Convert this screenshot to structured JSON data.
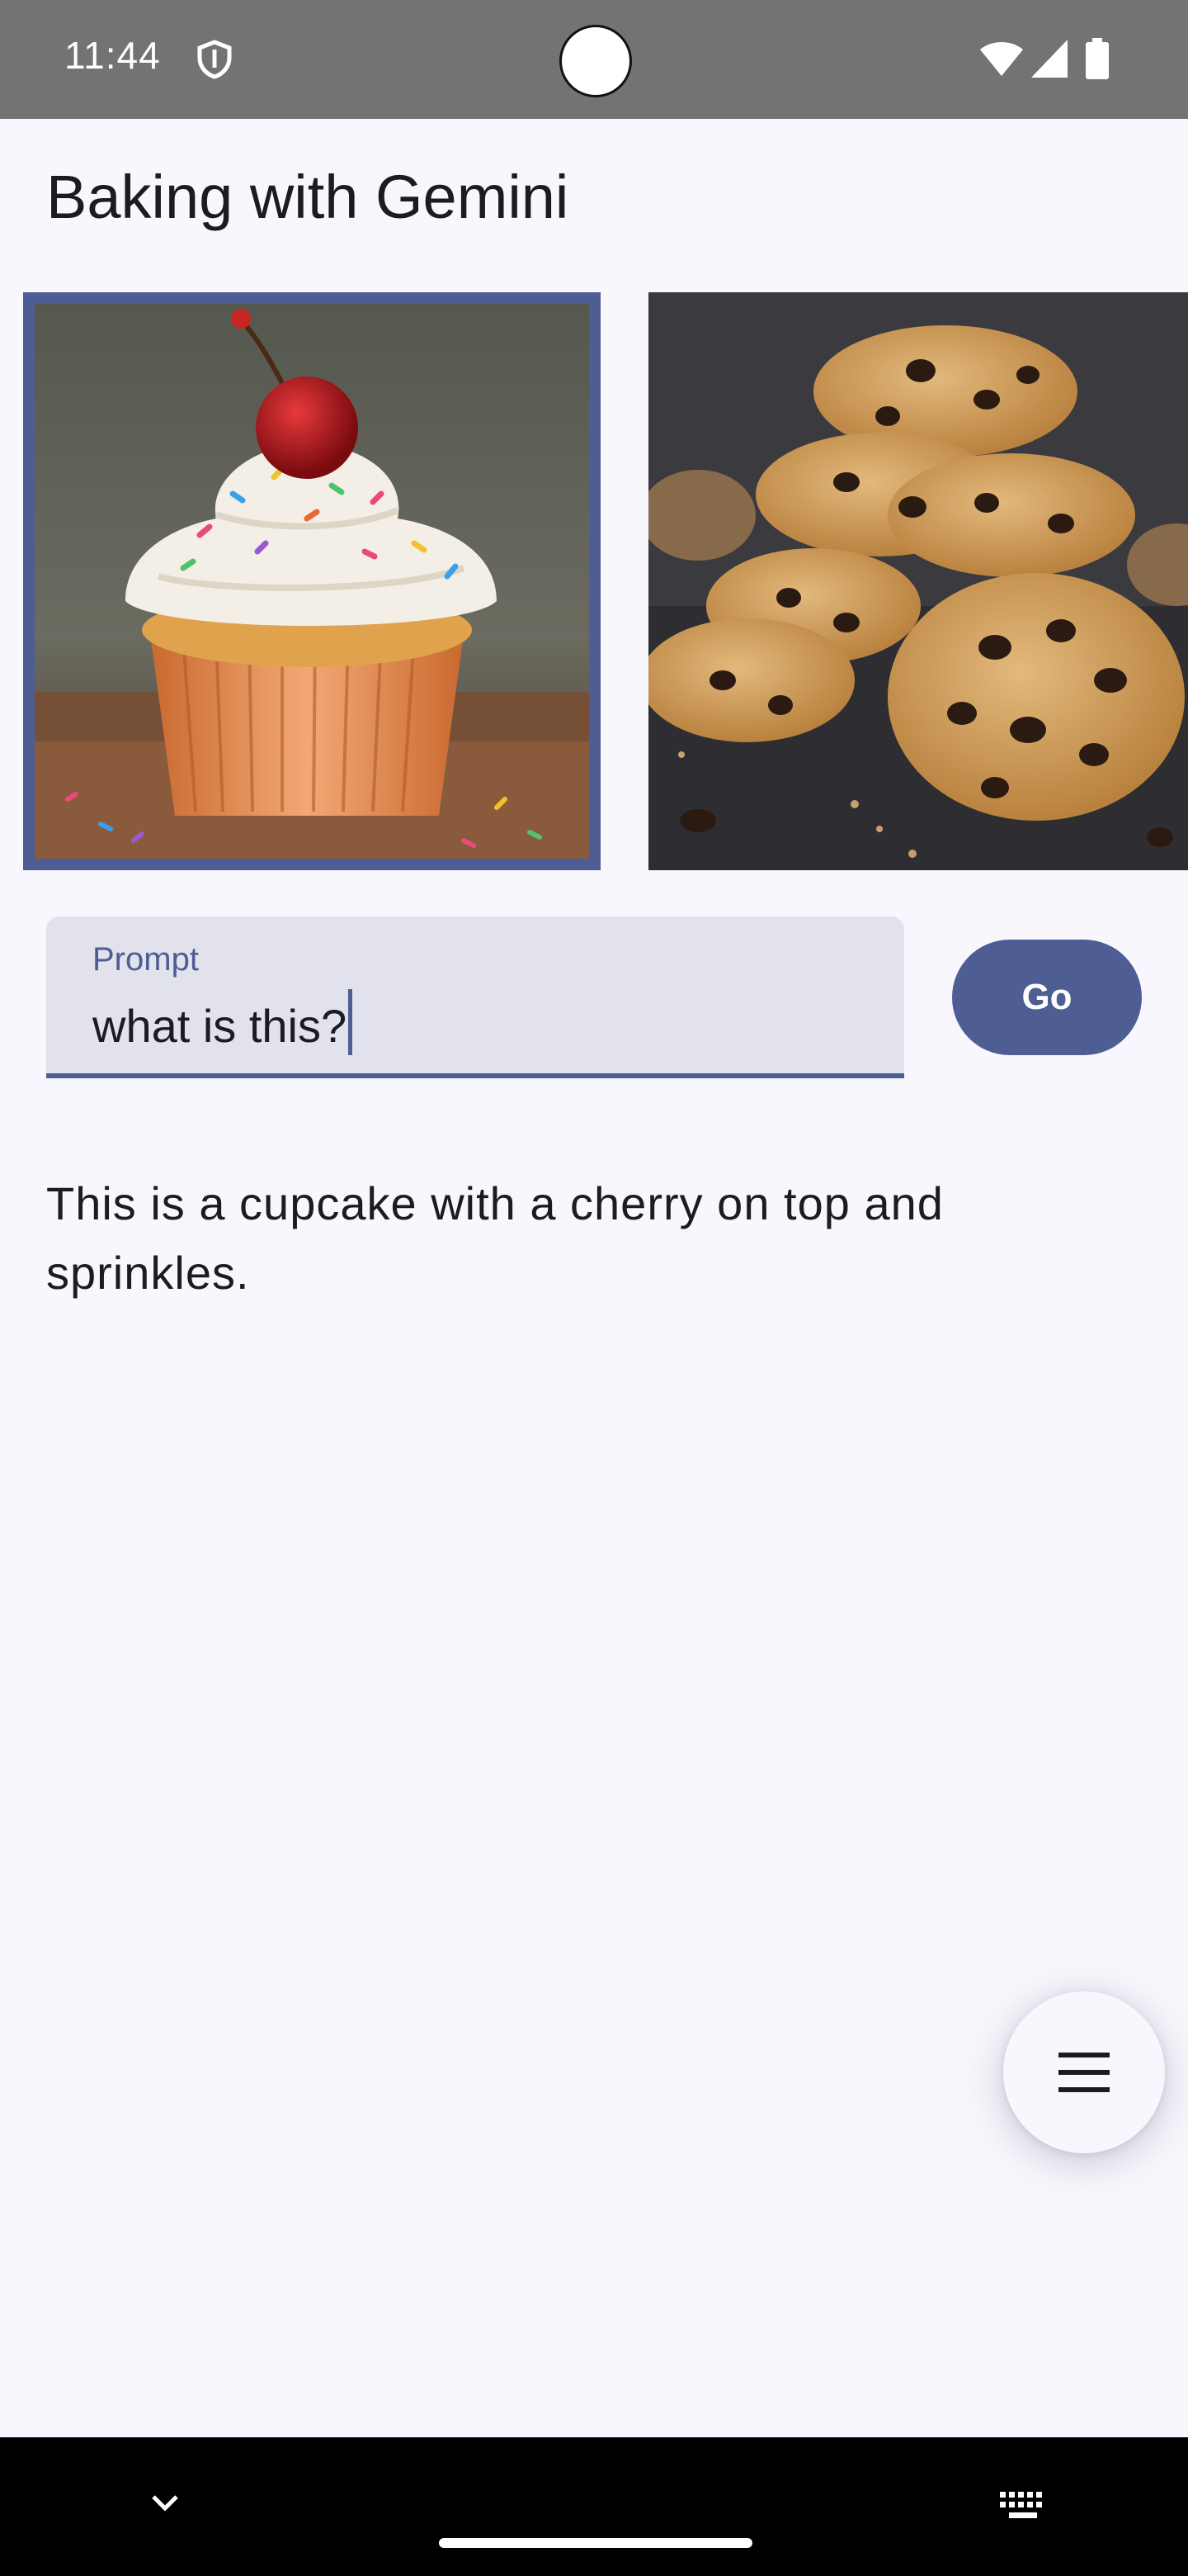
{
  "status_bar": {
    "time": "11:44",
    "icons": [
      "shield-icon",
      "wifi-icon",
      "signal-icon",
      "battery-icon"
    ]
  },
  "header": {
    "title": "Baking with Gemini"
  },
  "images": [
    {
      "subject": "cupcake",
      "selected": true
    },
    {
      "subject": "cookies",
      "selected": false
    }
  ],
  "prompt": {
    "label": "Prompt",
    "value": "what is this?"
  },
  "go_button": {
    "label": "Go"
  },
  "response": {
    "text": "This is a cupcake with a cherry on top and sprinkles."
  },
  "fab": {
    "icon": "menu-icon"
  },
  "nav_bar": {
    "icons": [
      "chevron-down-icon",
      "keyboard-icon"
    ]
  },
  "colors": {
    "accent": "#4e5d94",
    "background": "#f8f7fd",
    "field_background": "#e2e2ec",
    "status_bar": "#737373"
  }
}
